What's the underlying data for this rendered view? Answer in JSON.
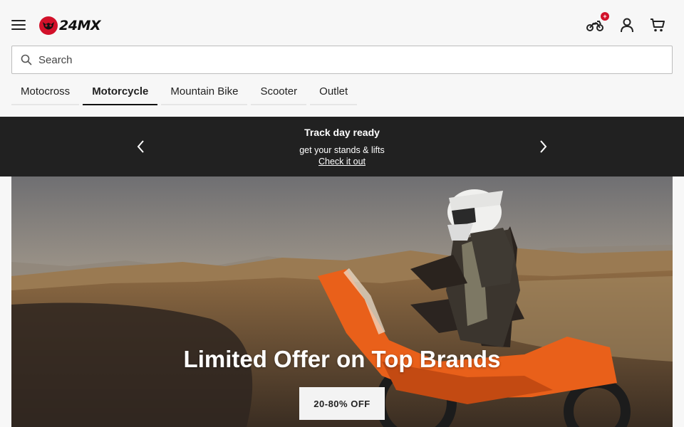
{
  "header": {
    "brand": "24MX",
    "garage_badge": "+",
    "search": {
      "placeholder": "Search",
      "value": ""
    }
  },
  "tabs": [
    {
      "label": "Motocross",
      "active": false
    },
    {
      "label": "Motorcycle",
      "active": true
    },
    {
      "label": "Mountain Bike",
      "active": false
    },
    {
      "label": "Scooter",
      "active": false
    },
    {
      "label": "Outlet",
      "active": false
    }
  ],
  "promo": {
    "title": "Track day ready",
    "subtitle": "get your stands & lifts",
    "link": "Check it out"
  },
  "hero": {
    "title": "Limited Offer on Top Brands",
    "button": "20-80% OFF"
  },
  "colors": {
    "accent": "#d2112a",
    "promo_bg": "#212121",
    "header_bg": "#f7f7f7"
  },
  "icons": {
    "menu": "hamburger-icon",
    "garage": "motorcycle-icon",
    "account": "user-icon",
    "cart": "cart-icon",
    "search": "search-icon",
    "prev": "chevron-left-icon",
    "next": "chevron-right-icon"
  }
}
